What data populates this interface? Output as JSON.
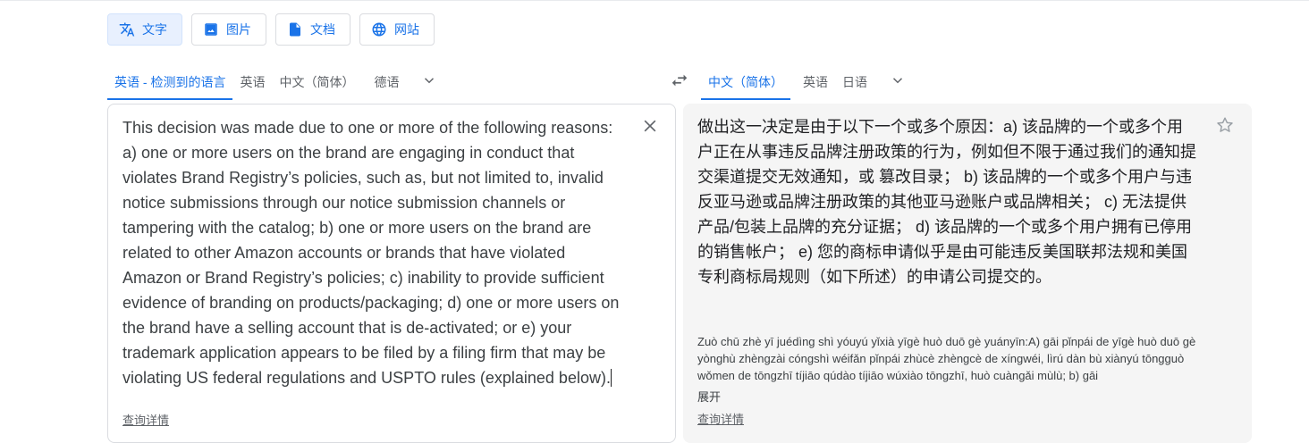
{
  "modes": [
    {
      "label": "文字",
      "icon": "translate-text-icon",
      "active": true
    },
    {
      "label": "图片",
      "icon": "image-icon",
      "active": false
    },
    {
      "label": "文档",
      "icon": "document-icon",
      "active": false
    },
    {
      "label": "网站",
      "icon": "globe-icon",
      "active": false
    }
  ],
  "source": {
    "languages": [
      "英语 - 检测到的语言",
      "英语",
      "中文（简体）",
      "德语"
    ],
    "text": "This decision was made due to one or more of the following reasons: a) one or more users on the brand are engaging in conduct that violates Brand Registry’s policies, such as, but not limited to, invalid notice submissions through our notice submission channels or tampering with the catalog; b) one or more users on the brand are related to other Amazon accounts or brands that have violated Amazon or Brand Registry’s policies; c) inability to provide sufficient evidence of branding on products/packaging; d) one or more users on the brand have a selling account that is de-activated; or e) your trademark application appears to be filed by a filing firm that may be violating US federal regulations and USPTO rules (explained below).",
    "more_link": "查询详情"
  },
  "target": {
    "languages": [
      "中文（简体）",
      "英语",
      "日语"
    ],
    "text": "做出这一决定是由于以下一个或多个原因：a) 该品牌的一个或多个用户正在从事违反品牌注册政策的行为，例如但不限于通过我们的通知提交渠道提交无效通知，或 篡改目录； b) 该品牌的一个或多个用户与违反亚马逊或品牌注册政策的其他亚马逊账户或品牌相关； c) 无法提供产品/包装上品牌的充分证据； d) 该品牌的一个或多个用户拥有已停用的销售帐户； e) 您的商标申请似乎是由可能违反美国联邦法规和美国专利商标局规则（如下所述）的申请公司提交的。",
    "pinyin": "Zuò chū zhè yī juédìng shì yóuyú yǐxià yīgè huò duō gè yuányīn:A) gāi pǐnpái de yīgè huò duō gè yònghù zhèngzài cóngshì wéifǎn pǐnpái zhùcè zhèngcè de xíngwéi, lìrú dàn bù xiànyú tōngguò wǒmen de tōngzhī tíjiāo qúdào tíjiāo wúxiào tōngzhī, huò cuàngǎi mùlù; b) gāi",
    "expand_label": "展开",
    "more_link": "查询详情"
  },
  "colors": {
    "accent": "#1a73e8",
    "active_bg": "#e8f0fe",
    "target_panel_bg": "#f5f5f5"
  }
}
